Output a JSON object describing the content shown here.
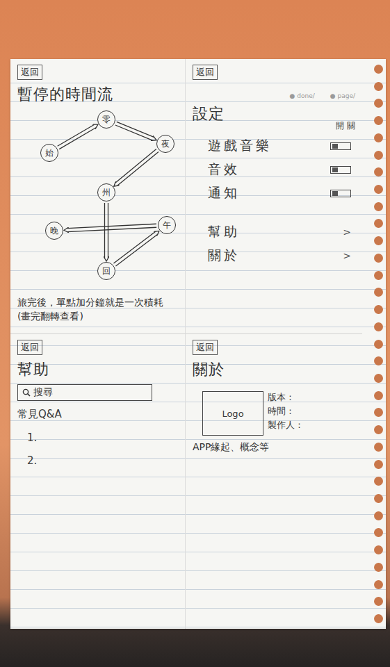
{
  "timeline": {
    "back": "返回",
    "title": "暫停的時間流",
    "nodes": [
      {
        "label": "始"
      },
      {
        "label": "零"
      },
      {
        "label": "夜"
      },
      {
        "label": "州"
      },
      {
        "label": "晚"
      },
      {
        "label": "回"
      },
      {
        "label": "午"
      }
    ],
    "edges": [
      {
        "from": 0,
        "to": 1
      },
      {
        "from": 1,
        "to": 2
      },
      {
        "from": 2,
        "to": 3
      },
      {
        "from": 3,
        "to": 5
      },
      {
        "from": 5,
        "to": 6
      },
      {
        "from": 6,
        "to": 4
      }
    ],
    "note": "旅完後，單點加分鐘就是一次積耗",
    "note_sub": "(畫完翻轉查看)"
  },
  "settings": {
    "back": "返回",
    "title": "設定",
    "marks": [
      "● done/",
      "● page/"
    ],
    "toggle_header": "開 關",
    "rows": [
      {
        "label": "遊戲音樂",
        "kind": "toggle",
        "on": false
      },
      {
        "label": "音效",
        "kind": "toggle",
        "on": false
      },
      {
        "label": "通知",
        "kind": "toggle",
        "on": false
      },
      {
        "label": "幫助",
        "kind": "link",
        "arrow": ">"
      },
      {
        "label": "關於",
        "kind": "link",
        "arrow": ">"
      }
    ]
  },
  "help": {
    "back": "返回",
    "title": "幫助",
    "search": {
      "placeholder": "搜尋"
    },
    "faq_title": "常見Q&A",
    "faq": [
      "1.",
      "2."
    ]
  },
  "about": {
    "back": "返回",
    "title": "關於",
    "logo": "Logo",
    "fields": [
      "版本：",
      "時間：",
      "製作人："
    ],
    "note": "APP緣起、概念等"
  }
}
